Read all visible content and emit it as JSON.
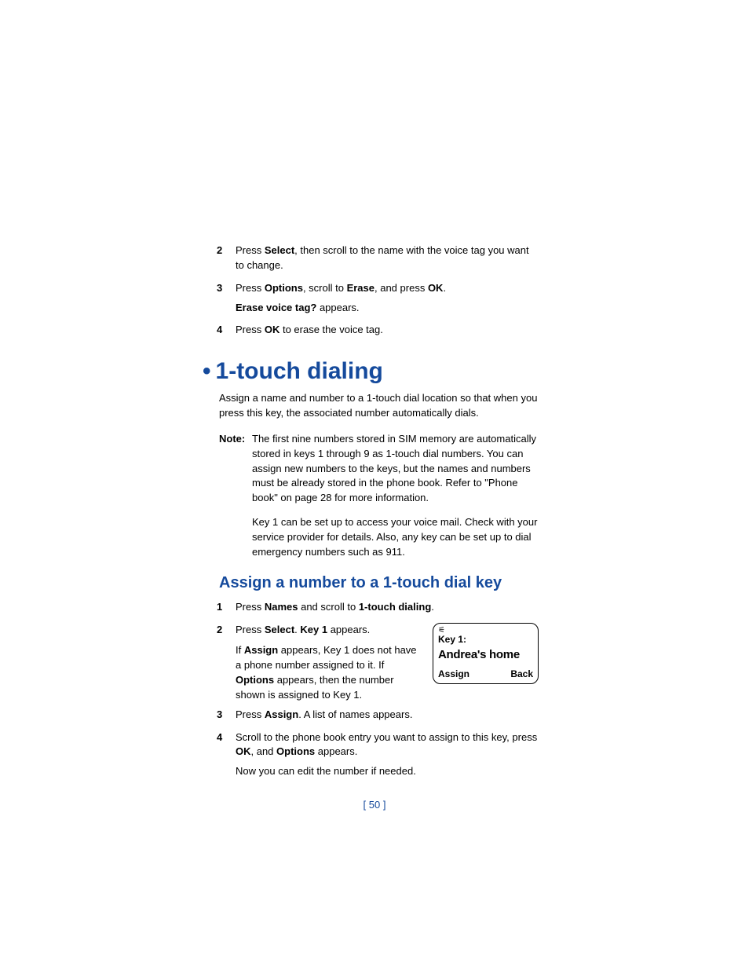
{
  "steps_top": [
    {
      "n": "2",
      "html_parts": [
        "Press ",
        {
          "b": "Select"
        },
        ", then scroll to the name with the voice tag you want to change."
      ]
    },
    {
      "n": "3",
      "html_parts": [
        "Press ",
        {
          "b": "Options"
        },
        ", scroll to ",
        {
          "b": "Erase"
        },
        ", and press ",
        {
          "b": "OK"
        },
        "."
      ]
    }
  ],
  "sub_after_3": [
    {
      "b": "Erase voice tag?"
    },
    " appears."
  ],
  "step4_top": {
    "n": "4",
    "html_parts": [
      "Press ",
      {
        "b": "OK"
      },
      " to erase the voice tag."
    ]
  },
  "section": {
    "bullet": "•",
    "title": "1-touch dialing"
  },
  "intro": "Assign a name and number to a 1-touch dial location so that when you press this key, the associated number automatically dials.",
  "note": {
    "label": "Note:",
    "p1": "The first nine numbers stored in SIM memory are automatically stored in keys 1 through 9 as 1-touch dial numbers. You can assign new numbers to the keys, but the names and numbers must be already stored in the phone book. Refer to \"Phone book\" on page 28 for more information.",
    "p2": "Key 1 can be set up to access your voice mail. Check with your service provider for details. Also, any key can be set up to dial emergency numbers such as 911."
  },
  "subsection": "Assign a number to a 1-touch dial key",
  "steps_bottom": {
    "s1": {
      "n": "1",
      "html_parts": [
        "Press ",
        {
          "b": "Names"
        },
        " and scroll to ",
        {
          "b": "1-touch dialing"
        },
        "."
      ]
    },
    "s2": {
      "n": "2",
      "line1": [
        "Press ",
        {
          "b": "Select"
        },
        ". ",
        {
          "b": "Key 1"
        },
        " appears."
      ],
      "line2": [
        "If ",
        {
          "b": "Assign"
        },
        " appears, Key 1 does not have a phone number assigned to it. If ",
        {
          "b": "Options"
        },
        " appears, then the number shown is assigned to Key 1."
      ]
    },
    "s3": {
      "n": "3",
      "html_parts": [
        "Press ",
        {
          "b": "Assign"
        },
        ". A list of names appears."
      ]
    },
    "s4": {
      "n": "4",
      "html_parts": [
        "Scroll to the phone book entry you want to assign to this key, press ",
        {
          "b": "OK"
        },
        ", and ",
        {
          "b": "Options"
        },
        " appears."
      ]
    },
    "s4_after": "Now you can edit the number if needed."
  },
  "phone": {
    "signal_glyph": "⚟",
    "key_label": "Key 1:",
    "name": "Andrea's home",
    "soft_left": "Assign",
    "soft_right": "Back"
  },
  "page_number": "[ 50 ]"
}
